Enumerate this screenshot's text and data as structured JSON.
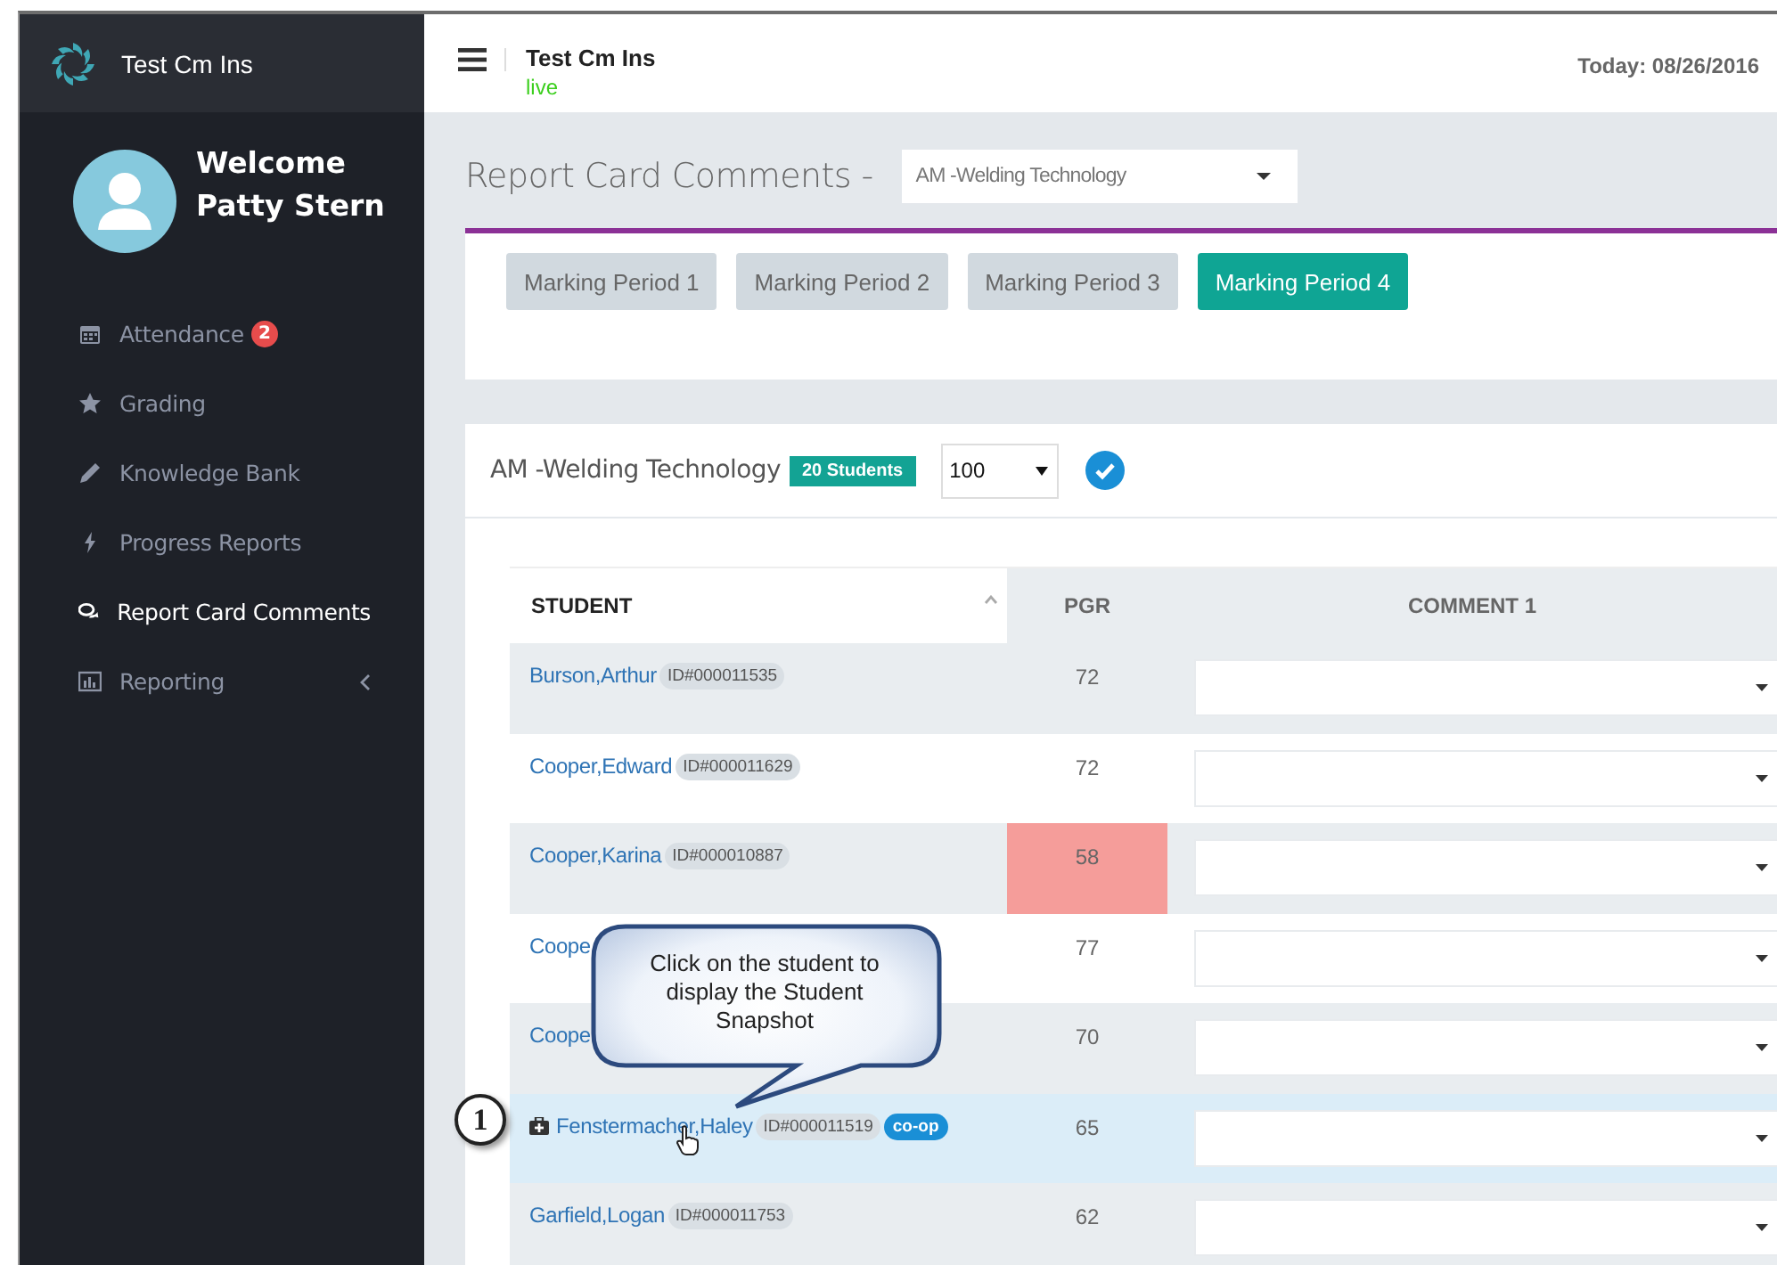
{
  "app": {
    "name": "Test Cm Ins"
  },
  "user": {
    "greeting": "Welcome",
    "name": "Patty Stern"
  },
  "nav": [
    {
      "label": "Attendance",
      "kind": "calendar",
      "badge": "2",
      "selected": false,
      "expandable": false
    },
    {
      "label": "Grading",
      "kind": "star",
      "selected": false,
      "expandable": false
    },
    {
      "label": "Knowledge Bank",
      "kind": "pencil",
      "selected": false,
      "expandable": false
    },
    {
      "label": "Progress Reports",
      "kind": "bolt",
      "selected": false,
      "expandable": false
    },
    {
      "label": "Report Card Comments",
      "kind": "comments",
      "selected": true,
      "expandable": false
    },
    {
      "label": "Reporting",
      "kind": "chart",
      "selected": false,
      "expandable": true
    }
  ],
  "header": {
    "title": "Test Cm Ins",
    "status": "live",
    "date": "Today: 08/26/2016"
  },
  "page": {
    "title": "Report Card Comments -",
    "course_select": "AM -Welding Technology"
  },
  "periods": [
    {
      "label": "Marking Period 1",
      "selected": false
    },
    {
      "label": "Marking Period 2",
      "selected": false
    },
    {
      "label": "Marking Period 3",
      "selected": false
    },
    {
      "label": "Marking Period 4",
      "selected": true
    }
  ],
  "section": {
    "course": "AM -Welding Technology",
    "count_badge": "20 Students",
    "page_size": "100"
  },
  "table": {
    "columns": [
      {
        "label": "STUDENT",
        "sorted": true
      },
      {
        "label": "PGR",
        "sorted": false
      },
      {
        "label": "COMMENT 1",
        "sorted": false
      }
    ],
    "rows": [
      {
        "name": "Burson,Arthur",
        "id": "ID#000011535",
        "pgr": "72",
        "flagged": false,
        "selected": false
      },
      {
        "name": "Cooper,Edward",
        "id": "ID#000011629",
        "pgr": "72",
        "flagged": false,
        "selected": false
      },
      {
        "name": "Cooper,Karina",
        "id": "ID#000010887",
        "pgr": "58",
        "flagged": true,
        "selected": false
      },
      {
        "name": "Coope",
        "pgr": "77",
        "flagged": false,
        "selected": false
      },
      {
        "name": "Coope",
        "pgr": "70",
        "flagged": false,
        "selected": false
      },
      {
        "name": "Fenstermacher,Haley",
        "id": "ID#000011519",
        "tag": "co-op",
        "kind": "medkit",
        "pgr": "65",
        "flagged": false,
        "selected": true
      },
      {
        "name": "Garfield,Logan",
        "id": "ID#000011753",
        "pgr": "62",
        "flagged": false,
        "selected": false
      }
    ]
  },
  "callout": {
    "marker": "1",
    "text": "Click on the student to display the Student Snapshot"
  }
}
